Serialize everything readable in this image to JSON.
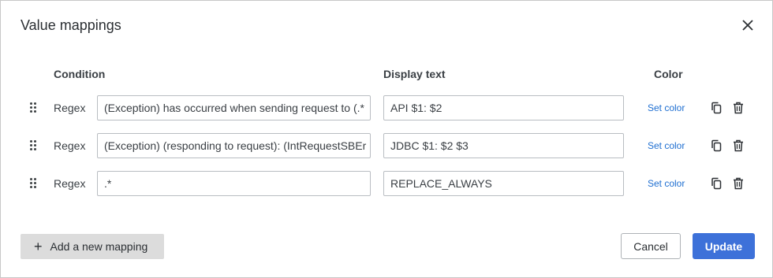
{
  "dialog": {
    "title": "Value mappings",
    "close_icon": "close-icon"
  },
  "table": {
    "headers": {
      "condition": "Condition",
      "display_text": "Display text",
      "color": "Color"
    },
    "rows": [
      {
        "type": "Regex",
        "condition": "(Exception) has occurred when sending request to (.*",
        "display_text": "API $1: $2",
        "set_color": "Set color"
      },
      {
        "type": "Regex",
        "condition": "(Exception) (responding to request): (IntRequestSBEr",
        "display_text": "JDBC $1: $2 $3",
        "set_color": "Set color"
      },
      {
        "type": "Regex",
        "condition": ".*",
        "display_text": "REPLACE_ALWAYS",
        "set_color": "Set color"
      }
    ]
  },
  "footer": {
    "add_label": "Add a new mapping",
    "cancel_label": "Cancel",
    "update_label": "Update"
  },
  "colors": {
    "accent": "#3d71d9",
    "link": "#1f6fd1",
    "add_button_bg": "#dcdcdc"
  }
}
